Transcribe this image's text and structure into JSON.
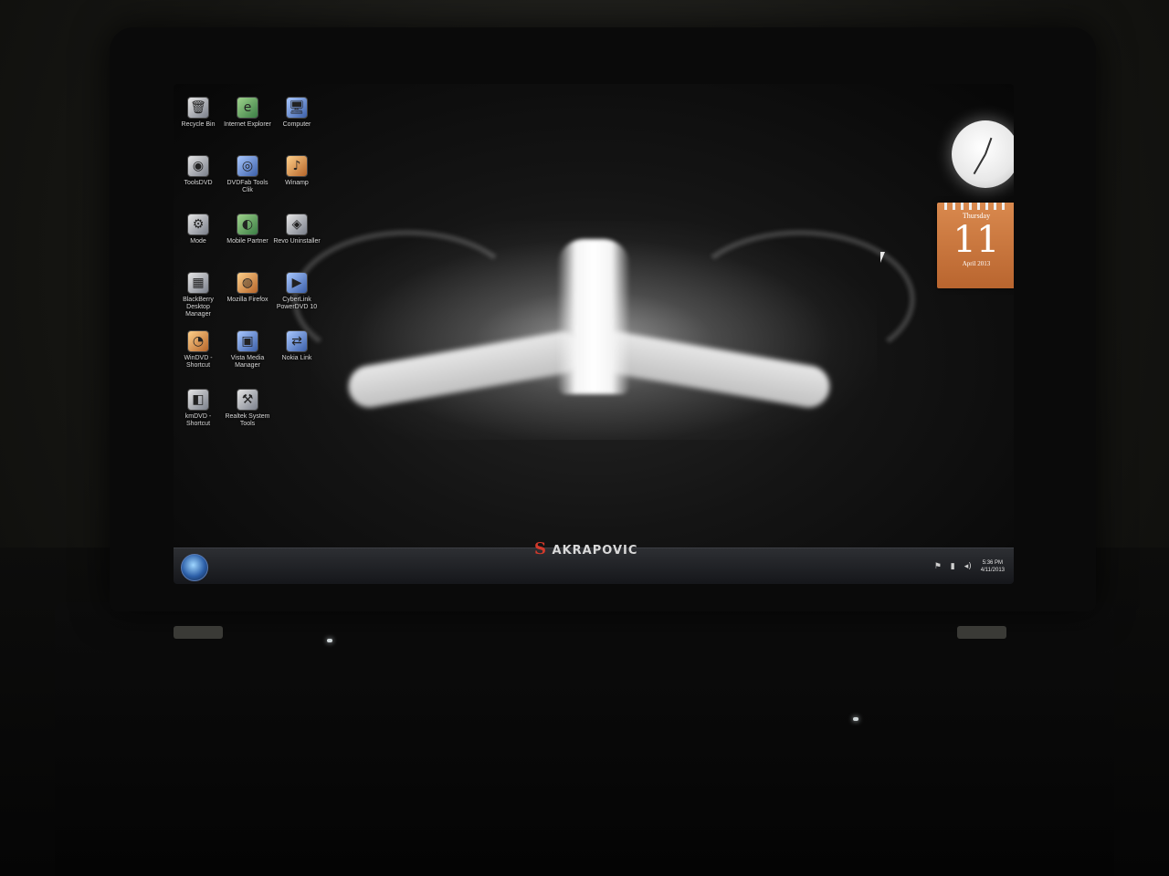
{
  "desktop": {
    "icons": [
      {
        "label": "Recycle Bin",
        "glyph": "recycle-bin-icon",
        "char": "🗑",
        "tone": ""
      },
      {
        "label": "Internet Explorer",
        "glyph": "internet-explorer-icon",
        "char": "e",
        "tone": "color-1"
      },
      {
        "label": "Computer",
        "glyph": "computer-icon",
        "char": "🖥",
        "tone": "color-2"
      },
      {
        "label": "ToolsDVD",
        "glyph": "tools-dvd-icon",
        "char": "◉",
        "tone": ""
      },
      {
        "label": "DVDFab Tools Clik",
        "glyph": "dvdfab-icon",
        "char": "◎",
        "tone": "color-2"
      },
      {
        "label": "Winamp",
        "glyph": "winamp-icon",
        "char": "♪",
        "tone": "color-3"
      },
      {
        "label": "Mode",
        "glyph": "mode-icon",
        "char": "⚙",
        "tone": ""
      },
      {
        "label": "Mobile Partner",
        "glyph": "mobile-partner-icon",
        "char": "◐",
        "tone": "color-1"
      },
      {
        "label": "Revo Uninstaller",
        "glyph": "revo-uninstaller-icon",
        "char": "◈",
        "tone": ""
      },
      {
        "label": "BlackBerry Desktop Manager",
        "glyph": "blackberry-icon",
        "char": "▦",
        "tone": ""
      },
      {
        "label": "Mozilla Firefox",
        "glyph": "firefox-icon",
        "char": "◍",
        "tone": "color-3"
      },
      {
        "label": "CyberLink PowerDVD 10",
        "glyph": "powerdvd-icon",
        "char": "▶",
        "tone": "color-2"
      },
      {
        "label": "WinDVD - Shortcut",
        "glyph": "windvd-icon",
        "char": "◔",
        "tone": "color-3"
      },
      {
        "label": "Vista Media Manager",
        "glyph": "media-manager-icon",
        "char": "▣",
        "tone": "color-2"
      },
      {
        "label": "Nokia Link",
        "glyph": "nokia-link-icon",
        "char": "⇄",
        "tone": "color-2"
      },
      {
        "label": "kmDVD - Shortcut",
        "glyph": "kmdvd-icon",
        "char": "◧",
        "tone": ""
      },
      {
        "label": "Realtek System Tools",
        "glyph": "realtek-icon",
        "char": "⚒",
        "tone": ""
      }
    ]
  },
  "calendar": {
    "day_name": "Thursday",
    "day_number": "11",
    "month_year": "April 2013"
  },
  "taskbar": {
    "brand_mark": "S",
    "brand_text": "AKRAPOVIC",
    "time": "5:36 PM",
    "date": "4/11/2013"
  },
  "tray": {
    "flag": "⚑",
    "network": "▮",
    "volume": "◂)"
  }
}
